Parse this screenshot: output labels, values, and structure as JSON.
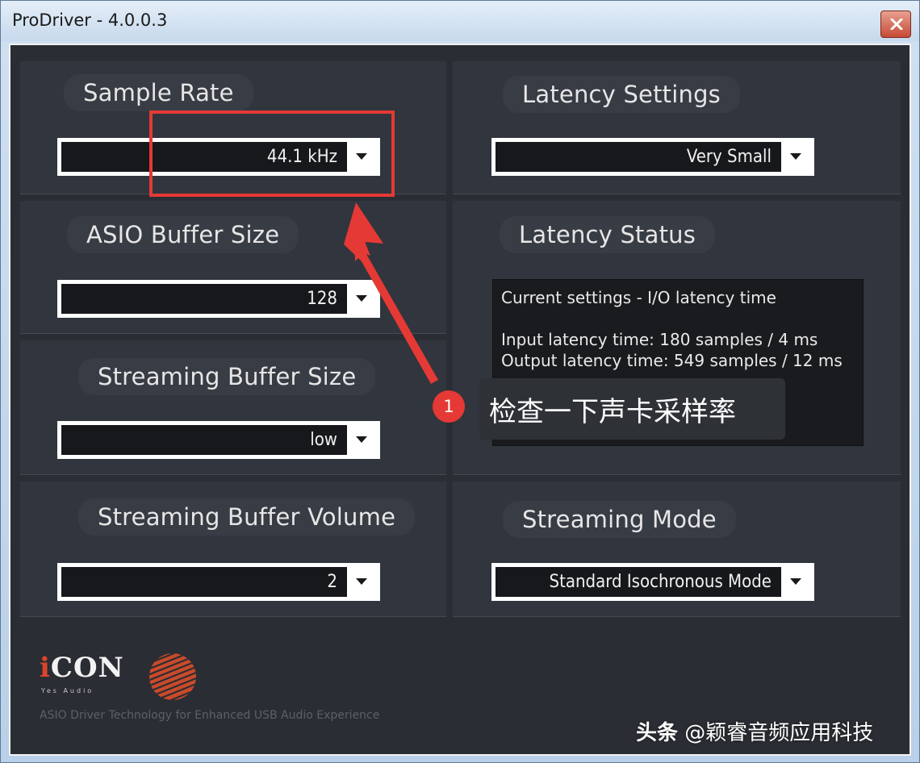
{
  "window": {
    "title": "ProDriver - 4.0.0.3"
  },
  "sample_rate": {
    "label": "Sample Rate",
    "value": "44.1 kHz"
  },
  "latency_settings": {
    "label": "Latency Settings",
    "value": "Very Small"
  },
  "asio_buffer": {
    "label": "ASIO Buffer Size",
    "value": "128"
  },
  "latency_status": {
    "label": "Latency Status",
    "line1": "Current settings - I/O latency time",
    "line2": "Input latency time: 180 samples / 4 ms",
    "line3": "Output latency time: 549 samples / 12 ms"
  },
  "streaming_buffer_size": {
    "label": "Streaming Buffer Size",
    "value": "low"
  },
  "streaming_buffer_volume": {
    "label": "Streaming Buffer Volume",
    "value": "2"
  },
  "streaming_mode": {
    "label": "Streaming Mode",
    "value": "Standard Isochronous Mode"
  },
  "annotation": {
    "badge": "1",
    "text": "检查一下声卡采样率",
    "color": "#e53935"
  },
  "logo": {
    "name_i": "i",
    "name_rest": "CON",
    "sub": "Yes Audio",
    "tagline": "ASIO Driver Technology for Enhanced USB Audio Experience"
  },
  "watermark": {
    "bold": "头条",
    "rest": " @颖睿音频应用科技"
  },
  "colors": {
    "panel_bg": "#31353d",
    "client_bg": "#2a2d33",
    "label_text": "#e6e6e6",
    "accent": "#e53935"
  }
}
